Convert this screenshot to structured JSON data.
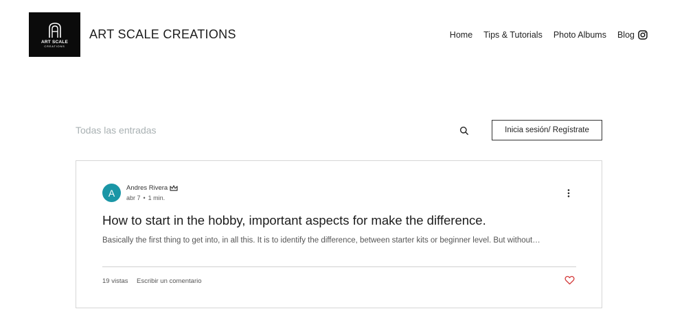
{
  "header": {
    "logo_line1": "ART SCALE",
    "logo_line2": "CREATIONS",
    "site_title": "ART SCALE CREATIONS",
    "nav": [
      "Home",
      "Tips & Tutorials",
      "Photo Albums",
      "Blog"
    ],
    "social_icon": "instagram-icon"
  },
  "blog": {
    "filter_label": "Todas las entradas",
    "login_label": "Inicia sesión/ Regístrate"
  },
  "post": {
    "avatar_letter": "A",
    "author": "Andres Rivera",
    "date": "abr 7",
    "read_time": "1 min.",
    "title": "How to start in the hobby, important aspects for make the difference.",
    "excerpt": "Basically the first thing to get into, in all this. It is to identify the difference, between starter kits or beginner level. But without…",
    "views": "19 vistas",
    "comment_label": "Escribir un comentario"
  },
  "colors": {
    "avatar": "#1a96a6",
    "heart": "#d43c3c",
    "logo_bg": "#0b0b0b"
  }
}
